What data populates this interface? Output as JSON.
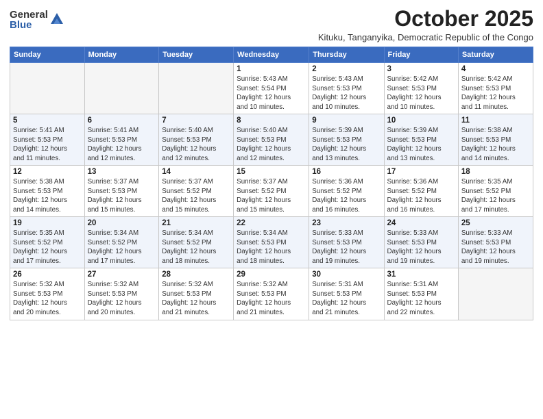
{
  "header": {
    "logo_general": "General",
    "logo_blue": "Blue",
    "month_title": "October 2025",
    "subtitle": "Kituku, Tanganyika, Democratic Republic of the Congo"
  },
  "days_of_week": [
    "Sunday",
    "Monday",
    "Tuesday",
    "Wednesday",
    "Thursday",
    "Friday",
    "Saturday"
  ],
  "weeks": [
    [
      {
        "day": "",
        "info": ""
      },
      {
        "day": "",
        "info": ""
      },
      {
        "day": "",
        "info": ""
      },
      {
        "day": "1",
        "info": "Sunrise: 5:43 AM\nSunset: 5:54 PM\nDaylight: 12 hours\nand 10 minutes."
      },
      {
        "day": "2",
        "info": "Sunrise: 5:43 AM\nSunset: 5:53 PM\nDaylight: 12 hours\nand 10 minutes."
      },
      {
        "day": "3",
        "info": "Sunrise: 5:42 AM\nSunset: 5:53 PM\nDaylight: 12 hours\nand 10 minutes."
      },
      {
        "day": "4",
        "info": "Sunrise: 5:42 AM\nSunset: 5:53 PM\nDaylight: 12 hours\nand 11 minutes."
      }
    ],
    [
      {
        "day": "5",
        "info": "Sunrise: 5:41 AM\nSunset: 5:53 PM\nDaylight: 12 hours\nand 11 minutes."
      },
      {
        "day": "6",
        "info": "Sunrise: 5:41 AM\nSunset: 5:53 PM\nDaylight: 12 hours\nand 12 minutes."
      },
      {
        "day": "7",
        "info": "Sunrise: 5:40 AM\nSunset: 5:53 PM\nDaylight: 12 hours\nand 12 minutes."
      },
      {
        "day": "8",
        "info": "Sunrise: 5:40 AM\nSunset: 5:53 PM\nDaylight: 12 hours\nand 12 minutes."
      },
      {
        "day": "9",
        "info": "Sunrise: 5:39 AM\nSunset: 5:53 PM\nDaylight: 12 hours\nand 13 minutes."
      },
      {
        "day": "10",
        "info": "Sunrise: 5:39 AM\nSunset: 5:53 PM\nDaylight: 12 hours\nand 13 minutes."
      },
      {
        "day": "11",
        "info": "Sunrise: 5:38 AM\nSunset: 5:53 PM\nDaylight: 12 hours\nand 14 minutes."
      }
    ],
    [
      {
        "day": "12",
        "info": "Sunrise: 5:38 AM\nSunset: 5:53 PM\nDaylight: 12 hours\nand 14 minutes."
      },
      {
        "day": "13",
        "info": "Sunrise: 5:37 AM\nSunset: 5:53 PM\nDaylight: 12 hours\nand 15 minutes."
      },
      {
        "day": "14",
        "info": "Sunrise: 5:37 AM\nSunset: 5:52 PM\nDaylight: 12 hours\nand 15 minutes."
      },
      {
        "day": "15",
        "info": "Sunrise: 5:37 AM\nSunset: 5:52 PM\nDaylight: 12 hours\nand 15 minutes."
      },
      {
        "day": "16",
        "info": "Sunrise: 5:36 AM\nSunset: 5:52 PM\nDaylight: 12 hours\nand 16 minutes."
      },
      {
        "day": "17",
        "info": "Sunrise: 5:36 AM\nSunset: 5:52 PM\nDaylight: 12 hours\nand 16 minutes."
      },
      {
        "day": "18",
        "info": "Sunrise: 5:35 AM\nSunset: 5:52 PM\nDaylight: 12 hours\nand 17 minutes."
      }
    ],
    [
      {
        "day": "19",
        "info": "Sunrise: 5:35 AM\nSunset: 5:52 PM\nDaylight: 12 hours\nand 17 minutes."
      },
      {
        "day": "20",
        "info": "Sunrise: 5:34 AM\nSunset: 5:52 PM\nDaylight: 12 hours\nand 17 minutes."
      },
      {
        "day": "21",
        "info": "Sunrise: 5:34 AM\nSunset: 5:52 PM\nDaylight: 12 hours\nand 18 minutes."
      },
      {
        "day": "22",
        "info": "Sunrise: 5:34 AM\nSunset: 5:53 PM\nDaylight: 12 hours\nand 18 minutes."
      },
      {
        "day": "23",
        "info": "Sunrise: 5:33 AM\nSunset: 5:53 PM\nDaylight: 12 hours\nand 19 minutes."
      },
      {
        "day": "24",
        "info": "Sunrise: 5:33 AM\nSunset: 5:53 PM\nDaylight: 12 hours\nand 19 minutes."
      },
      {
        "day": "25",
        "info": "Sunrise: 5:33 AM\nSunset: 5:53 PM\nDaylight: 12 hours\nand 19 minutes."
      }
    ],
    [
      {
        "day": "26",
        "info": "Sunrise: 5:32 AM\nSunset: 5:53 PM\nDaylight: 12 hours\nand 20 minutes."
      },
      {
        "day": "27",
        "info": "Sunrise: 5:32 AM\nSunset: 5:53 PM\nDaylight: 12 hours\nand 20 minutes."
      },
      {
        "day": "28",
        "info": "Sunrise: 5:32 AM\nSunset: 5:53 PM\nDaylight: 12 hours\nand 21 minutes."
      },
      {
        "day": "29",
        "info": "Sunrise: 5:32 AM\nSunset: 5:53 PM\nDaylight: 12 hours\nand 21 minutes."
      },
      {
        "day": "30",
        "info": "Sunrise: 5:31 AM\nSunset: 5:53 PM\nDaylight: 12 hours\nand 21 minutes."
      },
      {
        "day": "31",
        "info": "Sunrise: 5:31 AM\nSunset: 5:53 PM\nDaylight: 12 hours\nand 22 minutes."
      },
      {
        "day": "",
        "info": ""
      }
    ]
  ]
}
